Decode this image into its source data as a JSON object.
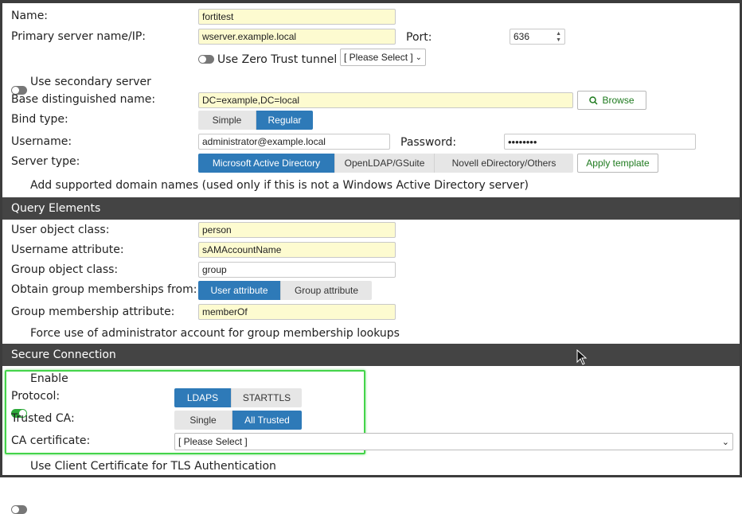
{
  "server": {
    "name_label": "Name:",
    "name_value": "fortitest",
    "primary_label": "Primary server name/IP:",
    "primary_value": "wserver.example.local",
    "port_label": "Port:",
    "port_value": "636",
    "zero_trust_label": "Use Zero Trust tunnel",
    "zero_trust_select": "[ Please Select ]",
    "secondary_label": "Use secondary server",
    "base_dn_label": "Base distinguished name:",
    "base_dn_value": "DC=example,DC=local",
    "browse_label": "Browse",
    "bind_type_label": "Bind type:",
    "bind_options": [
      "Simple",
      "Regular"
    ],
    "bind_selected": "Regular",
    "username_label": "Username:",
    "username_value": "administrator@example.local",
    "password_label": "Password:",
    "password_value": "••••••••",
    "server_type_label": "Server type:",
    "server_type_options": [
      "Microsoft Active Directory",
      "OpenLDAP/GSuite",
      "Novell eDirectory/Others"
    ],
    "server_type_selected": "Microsoft Active Directory",
    "apply_template_label": "Apply template",
    "domain_names_label": "Add supported domain names (used only if this is not a Windows Active Directory server)"
  },
  "query": {
    "section_title": "Query Elements",
    "user_class_label": "User object class:",
    "user_class_value": "person",
    "username_attr_label": "Username attribute:",
    "username_attr_value": "sAMAccountName",
    "group_class_label": "Group object class:",
    "group_class_value": "group",
    "membership_from_label": "Obtain group memberships from:",
    "membership_options": [
      "User attribute",
      "Group attribute"
    ],
    "membership_selected": "User attribute",
    "membership_attr_label": "Group membership attribute:",
    "membership_attr_value": "memberOf",
    "force_admin_label": "Force use of administrator account for group membership lookups"
  },
  "secure": {
    "section_title": "Secure Connection",
    "enable_label": "Enable",
    "protocol_label": "Protocol:",
    "protocol_options": [
      "LDAPS",
      "STARTTLS"
    ],
    "protocol_selected": "LDAPS",
    "trusted_ca_label": "Trusted CA:",
    "trusted_ca_options": [
      "Single",
      "All Trusted"
    ],
    "trusted_ca_selected": "All Trusted",
    "ca_cert_label": "CA certificate:",
    "ca_cert_select": "[ Please Select ]",
    "client_cert_label": "Use Client Certificate for TLS Authentication"
  },
  "colors": {
    "accent": "#2e7ab8",
    "section_bg": "#444444",
    "required_bg": "#fdfbd0",
    "toggle_on": "#2eaa3a",
    "highlight": "#44d44a"
  }
}
